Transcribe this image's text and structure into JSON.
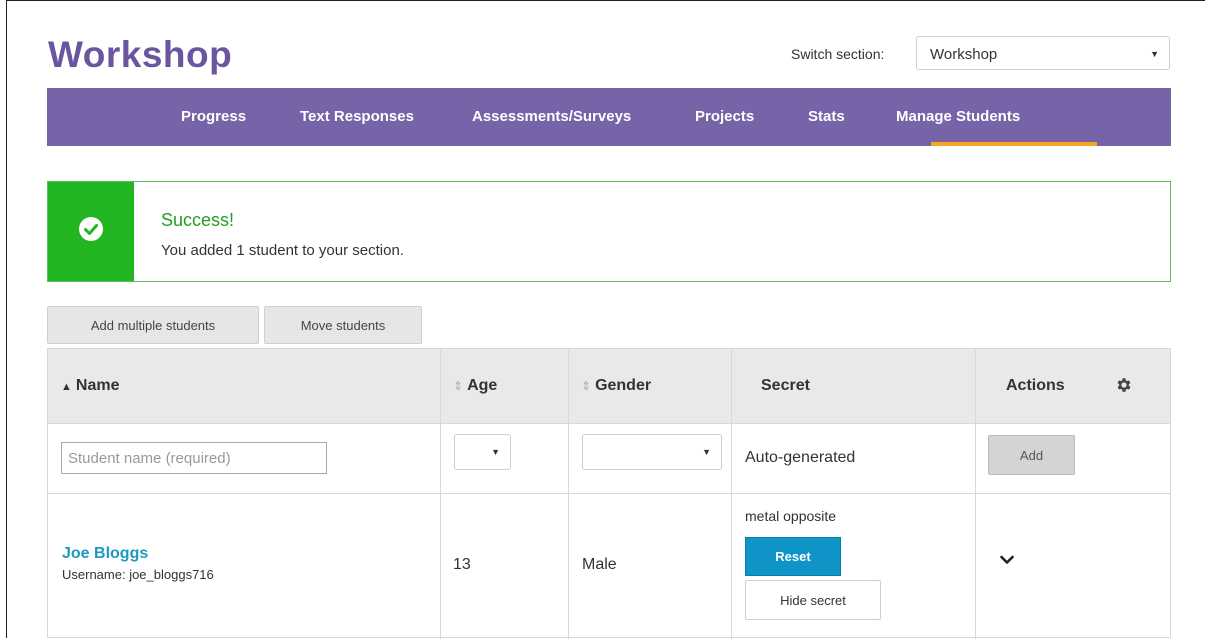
{
  "page": {
    "title": "Workshop",
    "switch_section": {
      "label": "Switch section:",
      "value": "Workshop"
    }
  },
  "nav": {
    "tabs": [
      {
        "label": "Progress"
      },
      {
        "label": "Text Responses"
      },
      {
        "label": "Assessments/Surveys"
      },
      {
        "label": "Projects"
      },
      {
        "label": "Stats"
      },
      {
        "label": "Manage Students",
        "active": true
      }
    ],
    "accent": "#7663a8",
    "active_underline": "#f5a623"
  },
  "alert": {
    "title": "Success!",
    "message": "You added 1 student to your section.",
    "icon": "check-circle-icon",
    "color": "#21b521"
  },
  "toolbar": {
    "add_multiple_label": "Add multiple students",
    "move_label": "Move students"
  },
  "table": {
    "headers": {
      "name": "Name",
      "age": "Age",
      "gender": "Gender",
      "secret": "Secret",
      "actions": "Actions"
    },
    "new_row": {
      "name_placeholder": "Student name (required)",
      "age_value": "",
      "gender_value": "",
      "secret_text": "Auto-generated",
      "add_label": "Add"
    },
    "rows": [
      {
        "name": "Joe Bloggs",
        "username": "Username: joe_bloggs716",
        "age": "13",
        "gender": "Male",
        "secret": "metal opposite",
        "reset_label": "Reset",
        "hide_label": "Hide secret"
      }
    ]
  }
}
